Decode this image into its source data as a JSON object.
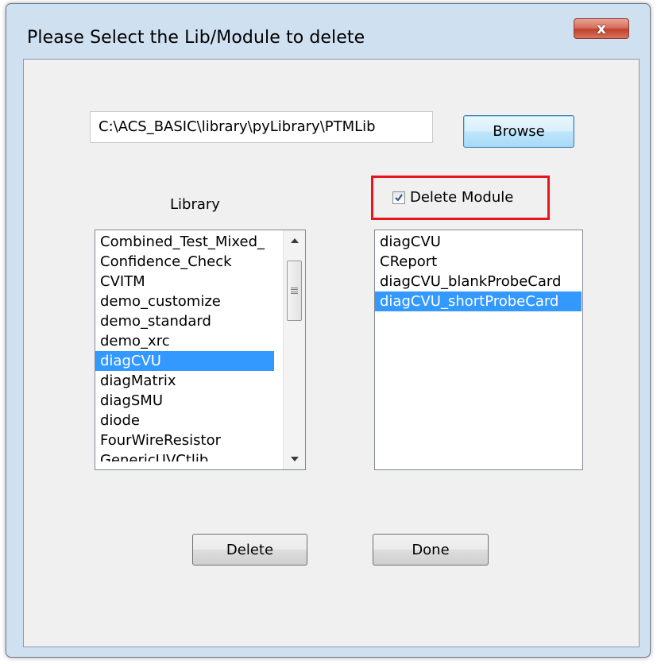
{
  "window": {
    "title": "Please Select the Lib/Module to delete",
    "close_label": "x"
  },
  "path": {
    "value": "C:\\ACS_BASIC\\library\\pyLibrary\\PTMLib"
  },
  "buttons": {
    "browse": "Browse",
    "delete": "Delete",
    "done": "Done"
  },
  "library": {
    "label": "Library",
    "items": [
      "Combined_Test_Mixed_",
      "Confidence_Check",
      "CVITM",
      "demo_customize",
      "demo_standard",
      "demo_xrc",
      "diagCVU",
      "diagMatrix",
      "diagSMU",
      "diode",
      "FourWireResistor",
      "GenericUVCtlib"
    ],
    "selected": "diagCVU"
  },
  "modules": {
    "checkbox_label": "Delete Module",
    "checkbox_checked": true,
    "items": [
      "diagCVU",
      "CReport",
      "diagCVU_blankProbeCard",
      "diagCVU_shortProbeCard"
    ],
    "selected": "diagCVU_shortProbeCard"
  },
  "colors": {
    "selection": "#3399ff",
    "highlight_frame": "#e8161a"
  }
}
